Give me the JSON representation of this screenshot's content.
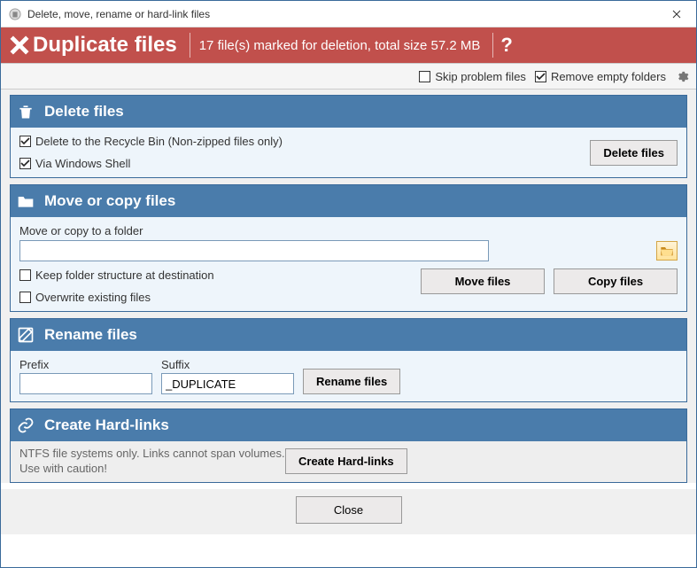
{
  "window": {
    "title": "Delete, move, rename or hard-link files"
  },
  "banner": {
    "headline": "Duplicate files",
    "status": "17 file(s) marked for deletion, total size 57.2 MB",
    "help": "?"
  },
  "options": {
    "skip_problem": "Skip problem files",
    "skip_problem_checked": false,
    "remove_empty": "Remove empty folders",
    "remove_empty_checked": true
  },
  "delete": {
    "header": "Delete files",
    "opt_recycle": "Delete to the Recycle Bin (Non-zipped files only)",
    "opt_recycle_checked": true,
    "opt_shell": "Via Windows Shell",
    "opt_shell_checked": true,
    "button": "Delete files"
  },
  "move": {
    "header": "Move or copy files",
    "label": "Move or copy to a folder",
    "value": "",
    "opt_keep": "Keep folder structure at destination",
    "opt_keep_checked": false,
    "opt_overwrite": "Overwrite existing files",
    "opt_overwrite_checked": false,
    "move_btn": "Move files",
    "copy_btn": "Copy files"
  },
  "rename": {
    "header": "Rename files",
    "prefix_label": "Prefix",
    "prefix_value": "",
    "suffix_label": "Suffix",
    "suffix_value": "_DUPLICATE",
    "button": "Rename files"
  },
  "hardlink": {
    "header": "Create Hard-links",
    "warning": "NTFS file systems only.  Links cannot span volumes.  Use with caution!",
    "button": "Create Hard-links"
  },
  "footer": {
    "close": "Close"
  }
}
